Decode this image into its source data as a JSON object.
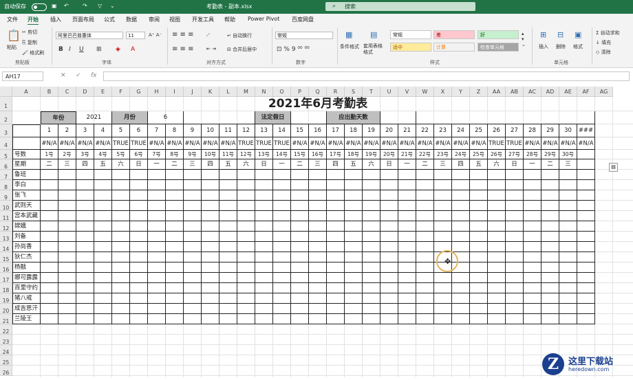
{
  "titlebar": {
    "autosave": "自动保存",
    "title": "考勤表 - 副本.xlsx",
    "search": "搜索"
  },
  "menu": [
    "文件",
    "开始",
    "插入",
    "页面布局",
    "公式",
    "数据",
    "审阅",
    "视图",
    "开发工具",
    "帮助",
    "Power Pivot",
    "百度网盘"
  ],
  "menu_active_index": 1,
  "ribbon": {
    "clipboard": {
      "paste": "粘贴",
      "cut": "剪切",
      "copy": "复制",
      "painter": "格式刷",
      "group": "剪贴板"
    },
    "font": {
      "name": "阿里巴巴普惠体",
      "size": "11",
      "group": "字体"
    },
    "align": {
      "wrap": "自动换行",
      "merge": "合并后居中",
      "group": "对齐方式"
    },
    "number": {
      "format": "常规",
      "group": "数字"
    },
    "styles": {
      "cond": "条件格式",
      "table": "套用表格格式",
      "group": "样式",
      "cells": [
        {
          "label": "常规",
          "bg": "#ffffff",
          "fg": "#222222"
        },
        {
          "label": "差",
          "bg": "#ffc7ce",
          "fg": "#9c0006"
        },
        {
          "label": "好",
          "bg": "#c6efce",
          "fg": "#006100"
        },
        {
          "label": "适中",
          "bg": "#ffeb9c",
          "fg": "#9c5700"
        },
        {
          "label": "计算",
          "bg": "#f2f2f2",
          "fg": "#fa7d00"
        },
        {
          "label": "检查单元格",
          "bg": "#a5a5a5",
          "fg": "#ffffff"
        }
      ]
    },
    "cells": {
      "insert": "插入",
      "delete": "删除",
      "format": "格式",
      "group": "单元格"
    },
    "edit": {
      "autosum": "自动求和",
      "fill": "填充",
      "clear": "清除"
    }
  },
  "formula": {
    "namebox": "AH17",
    "fx": "fx"
  },
  "sheet": {
    "columns": [
      "A",
      "B",
      "C",
      "D",
      "E",
      "F",
      "G",
      "H",
      "I",
      "J",
      "K",
      "L",
      "M",
      "N",
      "O",
      "P",
      "Q",
      "R",
      "S",
      "T",
      "U",
      "V",
      "W",
      "X",
      "Y",
      "Z",
      "AA",
      "AB",
      "AC",
      "AD",
      "AE",
      "AF",
      "AG"
    ],
    "rows": [
      "1",
      "2",
      "3",
      "4",
      "5",
      "6",
      "7",
      "8",
      "9",
      "10",
      "11",
      "12",
      "13",
      "14",
      "15",
      "16",
      "17",
      "18",
      "19",
      "20",
      "21",
      "22",
      "23",
      "24",
      "25",
      "26"
    ],
    "title": "2021年6月考勤表",
    "year_label": "年份",
    "year": "2021",
    "month_label": "月份",
    "month": "6",
    "holiday_label": "法定假日",
    "due_label": "应出勤天数",
    "days": [
      "1",
      "2",
      "3",
      "4",
      "5",
      "6",
      "7",
      "8",
      "9",
      "10",
      "11",
      "12",
      "13",
      "14",
      "15",
      "16",
      "17",
      "18",
      "19",
      "20",
      "21",
      "22",
      "23",
      "24",
      "25",
      "26",
      "27",
      "28",
      "29",
      "30",
      "###"
    ],
    "row4": [
      "#N/A",
      "#N/A",
      "#N/A",
      "#N/A",
      "TRUE",
      "TRUE",
      "#N/A",
      "#N/A",
      "#N/A",
      "#N/A",
      "#N/A",
      "TRUE",
      "TRUE",
      "TRUE",
      "#N/A",
      "#N/A",
      "#N/A",
      "#N/A",
      "#N/A",
      "#N/A",
      "#N/A",
      "#N/A",
      "#N/A",
      "#N/A",
      "#N/A",
      "TRUE",
      "TRUE",
      "#N/A",
      "#N/A",
      "#N/A",
      "#N/A"
    ],
    "hao_label": "号数",
    "hao": [
      "1号",
      "2号",
      "3号",
      "4号",
      "5号",
      "6号",
      "7号",
      "8号",
      "9号",
      "10号",
      "11号",
      "12号",
      "13号",
      "14号",
      "15号",
      "16号",
      "17号",
      "18号",
      "19号",
      "20号",
      "21号",
      "22号",
      "23号",
      "24号",
      "25号",
      "26号",
      "27号",
      "28号",
      "29号",
      "30号",
      ""
    ],
    "week_label": "星期",
    "week": [
      "二",
      "三",
      "四",
      "五",
      "六",
      "日",
      "一",
      "二",
      "三",
      "四",
      "五",
      "六",
      "日",
      "一",
      "二",
      "三",
      "四",
      "五",
      "六",
      "日",
      "一",
      "二",
      "三",
      "四",
      "五",
      "六",
      "日",
      "一",
      "二",
      "三",
      ""
    ],
    "names": [
      "鲁班",
      "李白",
      "张飞",
      "武则天",
      "宫本武藏",
      "嫦娥",
      "刘备",
      "孙尚香",
      "狄仁杰",
      "杨戬",
      "娜可露露",
      "百里守约",
      "猪八戒",
      "成吉思汗",
      "兰陵王"
    ]
  },
  "watermark": {
    "line1": "这里下载站",
    "line2": "heredown.com",
    "logo": "Z"
  }
}
